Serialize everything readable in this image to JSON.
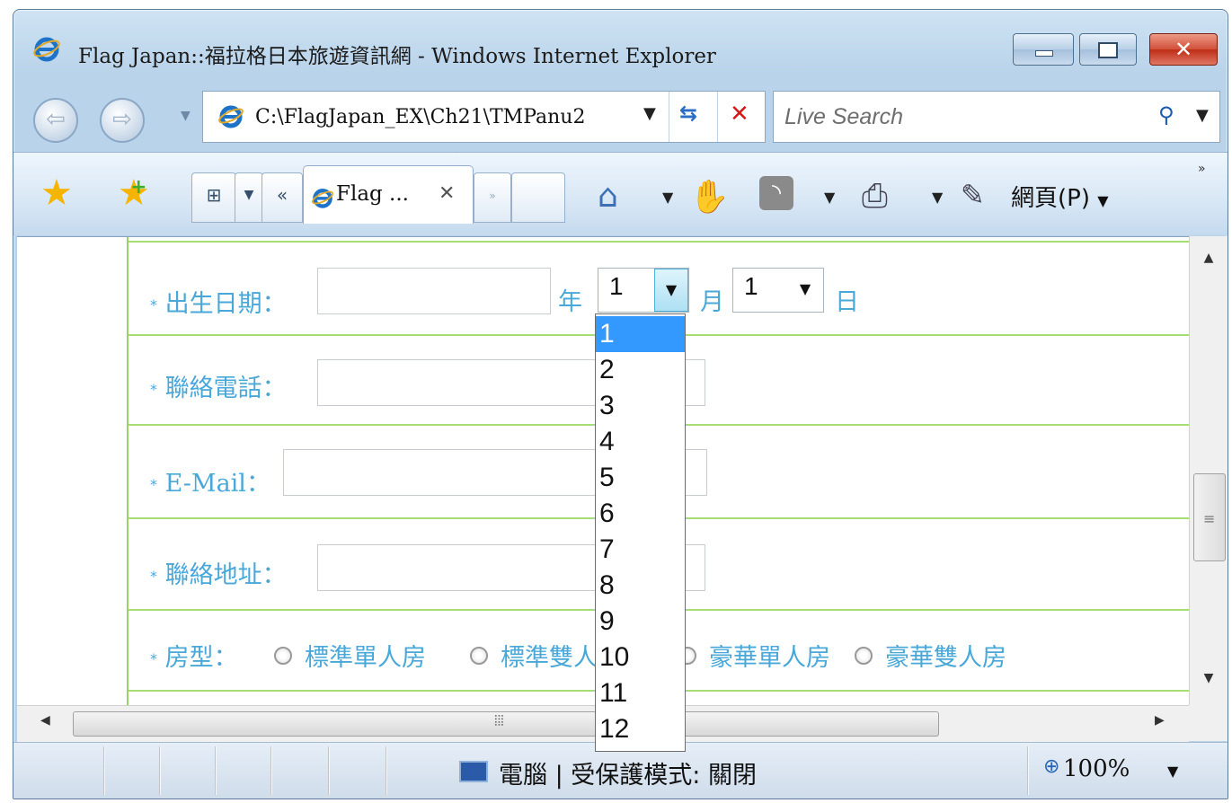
{
  "window": {
    "title": "Flag Japan::福拉格日本旅遊資訊網 - Windows Internet Explorer"
  },
  "address_bar": {
    "url": "C:\\FlagJapan_EX\\Ch21\\TMPanu2",
    "search_placeholder": "Live Search"
  },
  "tabs": {
    "active_tab_title": "Flag ...",
    "page_menu_label": "網頁(P)"
  },
  "form": {
    "birthdate": {
      "label": "出生日期：",
      "year_unit": "年",
      "month_value": "1",
      "month_unit": "月",
      "day_value": "1",
      "day_unit": "日"
    },
    "phone": {
      "label": "聯絡電話："
    },
    "email": {
      "label": "E-Mail："
    },
    "address": {
      "label": "聯絡地址："
    },
    "room_type": {
      "label": "房型：",
      "options": [
        "標準單人房",
        "標準雙人房",
        "豪華單人房",
        "豪華雙人房"
      ]
    },
    "required_marker": "*"
  },
  "month_dropdown": {
    "selected": "1",
    "options": [
      "1",
      "2",
      "3",
      "4",
      "5",
      "6",
      "7",
      "8",
      "9",
      "10",
      "11",
      "12"
    ]
  },
  "status_bar": {
    "zone_text": "電腦 | 受保護模式: 關閉",
    "zoom": "100%"
  },
  "colors": {
    "label_blue": "#4aa8d8",
    "row_border_green": "#a6dd74",
    "highlight": "#3399ff"
  }
}
